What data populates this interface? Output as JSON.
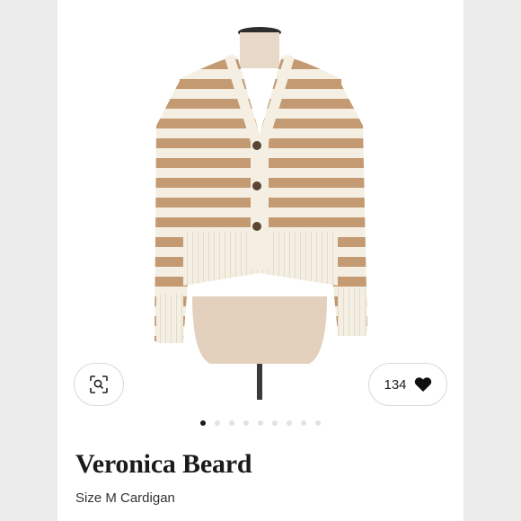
{
  "listing": {
    "brand": "Veronica Beard",
    "subtitle": "Size M Cardigan",
    "likes": "134",
    "photo_count": 9,
    "active_photo": 0
  },
  "icons": {
    "visual_search": "visual-search-icon",
    "like": "heart-icon"
  },
  "colors": {
    "stripe": "#c49a72",
    "knit": "#f4efe2",
    "page_bg": "#ececec"
  }
}
